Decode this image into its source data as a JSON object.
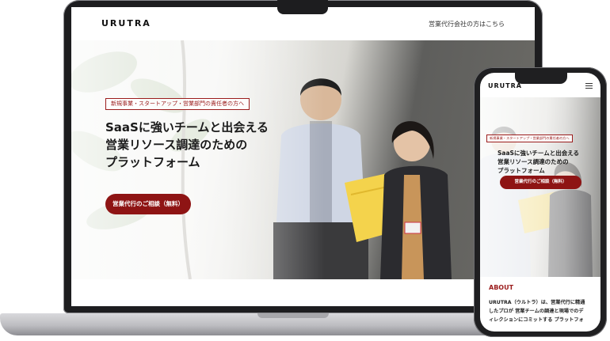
{
  "laptop": {
    "header": {
      "logo": "URUTRA",
      "link": "営業代行会社の方はこちら"
    },
    "hero": {
      "tagline": "新規事業・スタートアップ・営業部門の責任者の方へ",
      "title_lines": [
        "SaaSに強いチームと出会える",
        "営業リソース調達のための",
        "プラットフォーム"
      ],
      "cta": "営業代行のご相談（無料）"
    }
  },
  "phone": {
    "header": {
      "logo": "URUTRA",
      "menu_icon": "hamburger-menu-icon"
    },
    "hero": {
      "tagline": "新規事業・スタートアップ・営業部門の責任者の方へ",
      "title_lines": [
        "SaaSに強いチームと出会える",
        "営業リソース調達のための",
        "プラットフォーム"
      ],
      "cta": "営業代行のご相談（無料）"
    },
    "about": {
      "heading": "ABOUT",
      "body_lines": [
        "URUTRA（ウルトラ）は、営業代行に精通",
        "したプロが 営業チームの調達と現場でのデ",
        "ィレクションにコミットする プラットフォ"
      ]
    }
  },
  "colors": {
    "accent": "#8e1414",
    "device_frame": "#1d1d1f",
    "device_base": "#bdbdc1"
  }
}
